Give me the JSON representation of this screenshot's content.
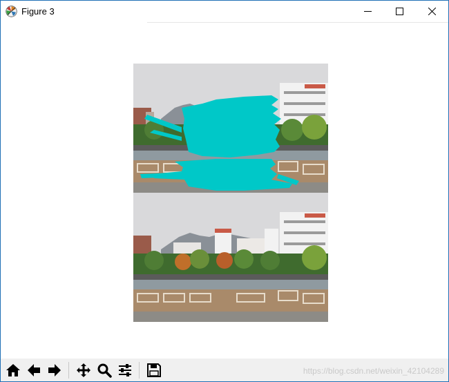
{
  "window": {
    "title": "Figure 3"
  },
  "window_controls": {
    "minimize_icon": "minimize-icon",
    "maximize_icon": "maximize-icon",
    "close_icon": "close-icon"
  },
  "figure": {
    "images": [
      {
        "name": "inpainting-mask-image",
        "mask_color": "#00c8c8"
      },
      {
        "name": "inpainted-result-image"
      }
    ]
  },
  "toolbar": {
    "buttons": [
      {
        "name": "home-button",
        "icon": "home-icon"
      },
      {
        "name": "back-button",
        "icon": "arrow-left-icon"
      },
      {
        "name": "forward-button",
        "icon": "arrow-right-icon"
      },
      {
        "name": "pan-button",
        "icon": "move-arrows-icon"
      },
      {
        "name": "zoom-button",
        "icon": "magnifier-icon"
      },
      {
        "name": "configure-subplots-button",
        "icon": "sliders-icon"
      },
      {
        "name": "save-button",
        "icon": "floppy-disk-icon"
      }
    ],
    "watermark": "https://blog.csdn.net/weixin_42104289"
  },
  "colors": {
    "accent_border": "#1f6fb5",
    "toolbar_bg": "#f0f0f0",
    "mask": "#00c8c8"
  }
}
